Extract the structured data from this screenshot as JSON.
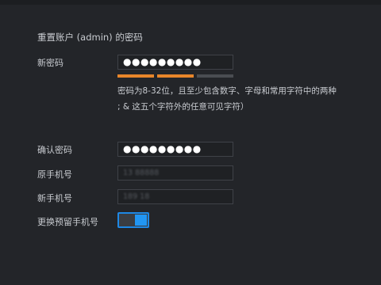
{
  "form": {
    "title": "重置账户 (admin) 的密码",
    "new_password": {
      "label": "新密码",
      "value": "●●●●●●●●●"
    },
    "strength": {
      "segments_filled": 2,
      "segments_total": 3,
      "color_filled": "#e8862a",
      "color_empty": "#4a4d52"
    },
    "hint_line1": "密码为8-32位，且至少包含数字、字母和常用字符中的两种",
    "hint_line2": "; & 这五个字符外的任意可见字符）",
    "confirm_password": {
      "label": "确认密码",
      "value": "●●●●●●●●●"
    },
    "old_phone": {
      "label": "原手机号",
      "value": "13 88888"
    },
    "new_phone": {
      "label": "新手机号",
      "value": "189          18"
    },
    "change_phone": {
      "label": "更换预留手机号",
      "enabled": true,
      "accent": "#1e88e5"
    }
  }
}
